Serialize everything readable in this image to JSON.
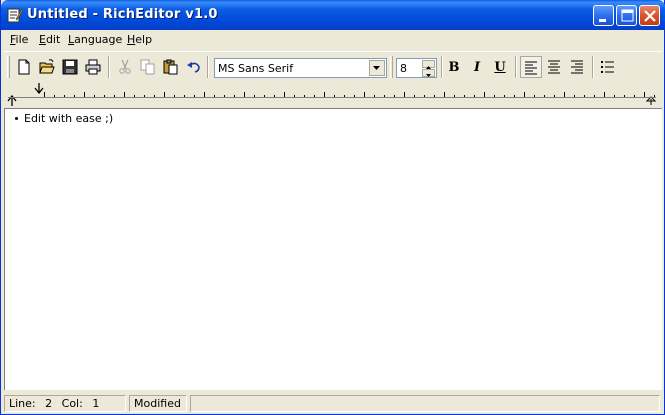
{
  "window": {
    "title": "Untitled - RichEditor v1.0"
  },
  "menu": [
    {
      "label_u": "F",
      "label_rest": "ile"
    },
    {
      "label_u": "E",
      "label_rest": "dit"
    },
    {
      "label_u": "L",
      "label_rest": "anguage"
    },
    {
      "label_u": "H",
      "label_rest": "elp"
    }
  ],
  "toolbar": {
    "font_name": "MS Sans Serif",
    "font_size": "8",
    "bold": "B",
    "italic": "I",
    "underline": "U"
  },
  "document": {
    "line1": "Edit with ease ;)"
  },
  "status": {
    "line_label": "Line:",
    "line_value": "2",
    "col_label": "Col:",
    "col_value": "1",
    "modified": "Modified"
  }
}
